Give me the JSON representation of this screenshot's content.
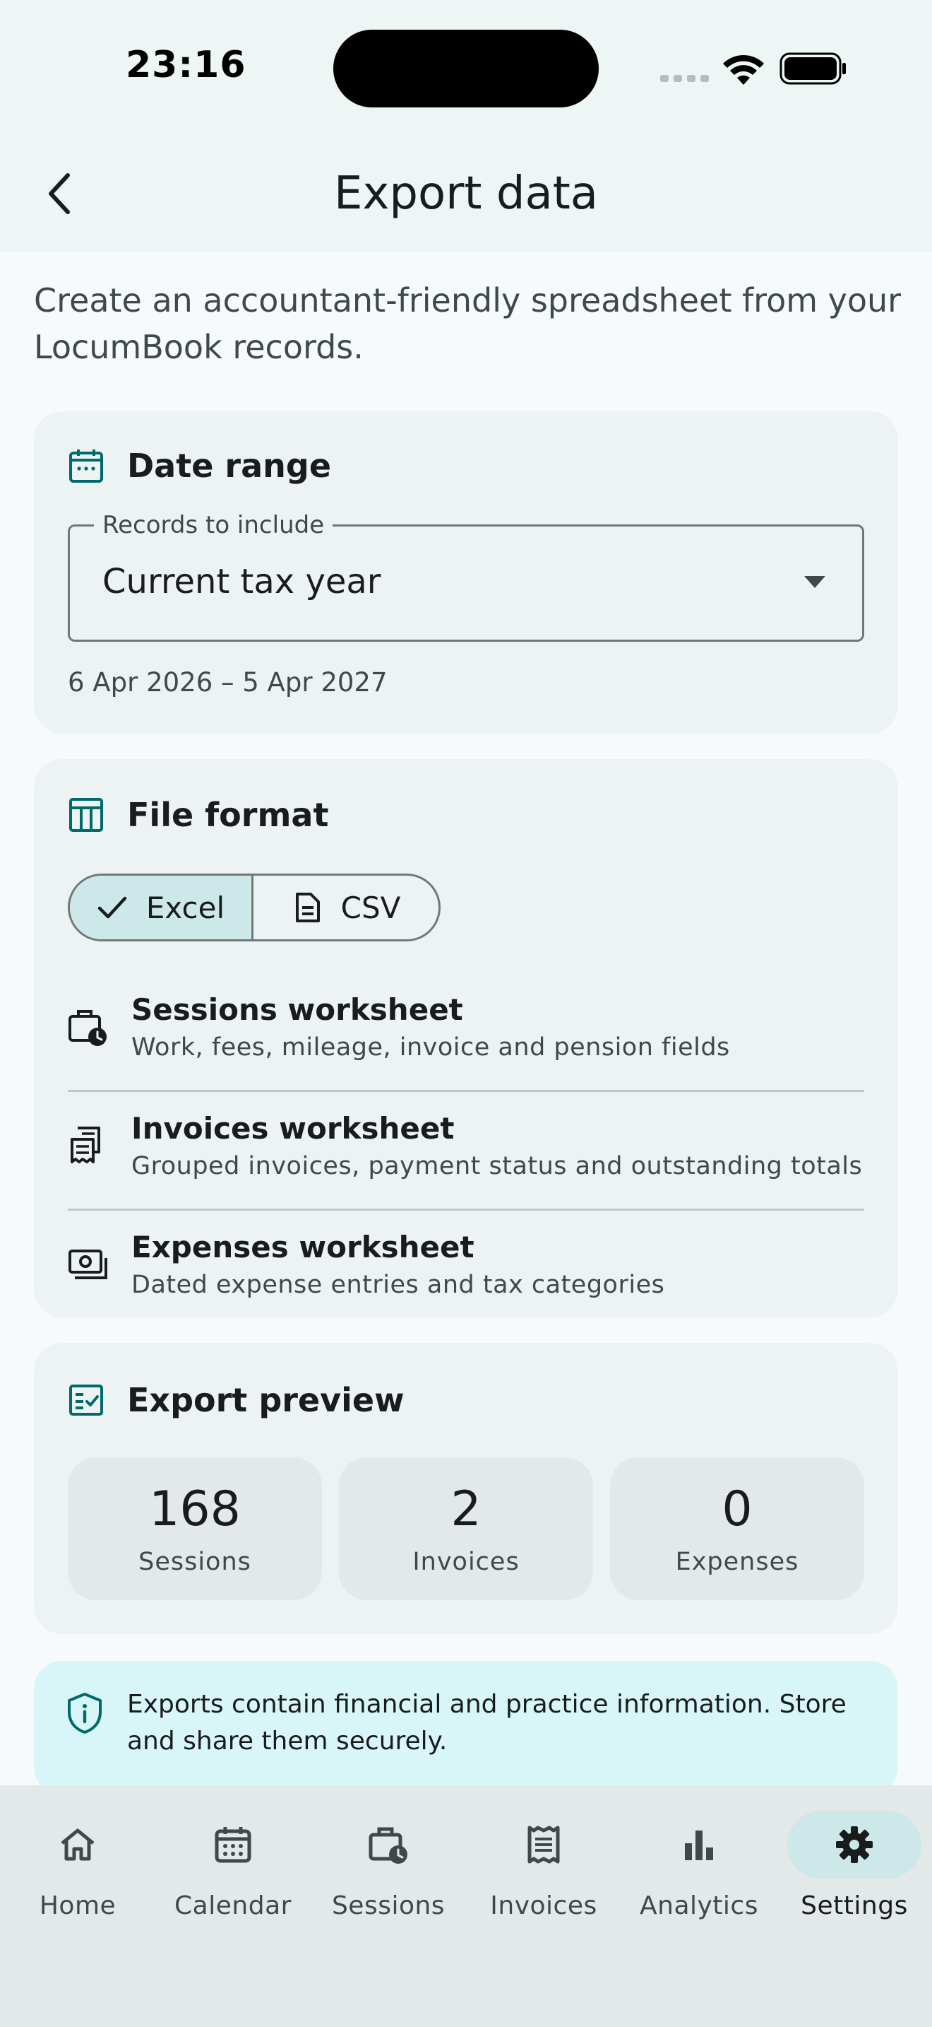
{
  "status_bar": {
    "time": "23:16"
  },
  "header": {
    "title": "Export data",
    "back_icon": "chevron-left-icon"
  },
  "intro": "Create an accountant-friendly spreadsheet from your LocumBook records.",
  "date_range": {
    "title": "Date range",
    "icon": "calendar-icon",
    "field_label": "Records to include",
    "selected": "Current tax year",
    "range_caption": "6 Apr 2026 – 5 Apr 2027"
  },
  "file_format": {
    "title": "File format",
    "icon": "table-icon",
    "options": [
      {
        "label": "Excel",
        "selected": true,
        "icon": "check-icon"
      },
      {
        "label": "CSV",
        "selected": false,
        "icon": "document-icon"
      }
    ],
    "worksheets": [
      {
        "title": "Sessions worksheet",
        "description": "Work, fees, mileage, invoice and pension fields",
        "icon": "briefcase-clock-icon"
      },
      {
        "title": "Invoices worksheet",
        "description": "Grouped invoices, payment status and outstanding totals",
        "icon": "receipt-icon"
      },
      {
        "title": "Expenses worksheet",
        "description": "Dated expense entries and tax categories",
        "icon": "cash-icon"
      }
    ]
  },
  "preview": {
    "title": "Export preview",
    "icon": "checklist-icon",
    "stats": [
      {
        "value": "168",
        "label": "Sessions"
      },
      {
        "value": "2",
        "label": "Invoices"
      },
      {
        "value": "0",
        "label": "Expenses"
      }
    ]
  },
  "security_note": {
    "icon": "shield-info-icon",
    "text": "Exports contain financial and practice information. Store and share them securely."
  },
  "nav": {
    "items": [
      {
        "label": "Home",
        "icon": "home-icon",
        "active": false
      },
      {
        "label": "Calendar",
        "icon": "calendar-icon",
        "active": false
      },
      {
        "label": "Sessions",
        "icon": "briefcase-clock-icon",
        "active": false
      },
      {
        "label": "Invoices",
        "icon": "receipt-icon",
        "active": false
      },
      {
        "label": "Analytics",
        "icon": "bar-chart-icon",
        "active": false
      },
      {
        "label": "Settings",
        "icon": "gear-icon",
        "active": true
      }
    ]
  },
  "colors": {
    "accent": "#00696b",
    "card_bg": "#edf3f3",
    "selected_bg": "#cde8e8",
    "info_bg": "#d8f6f8"
  }
}
